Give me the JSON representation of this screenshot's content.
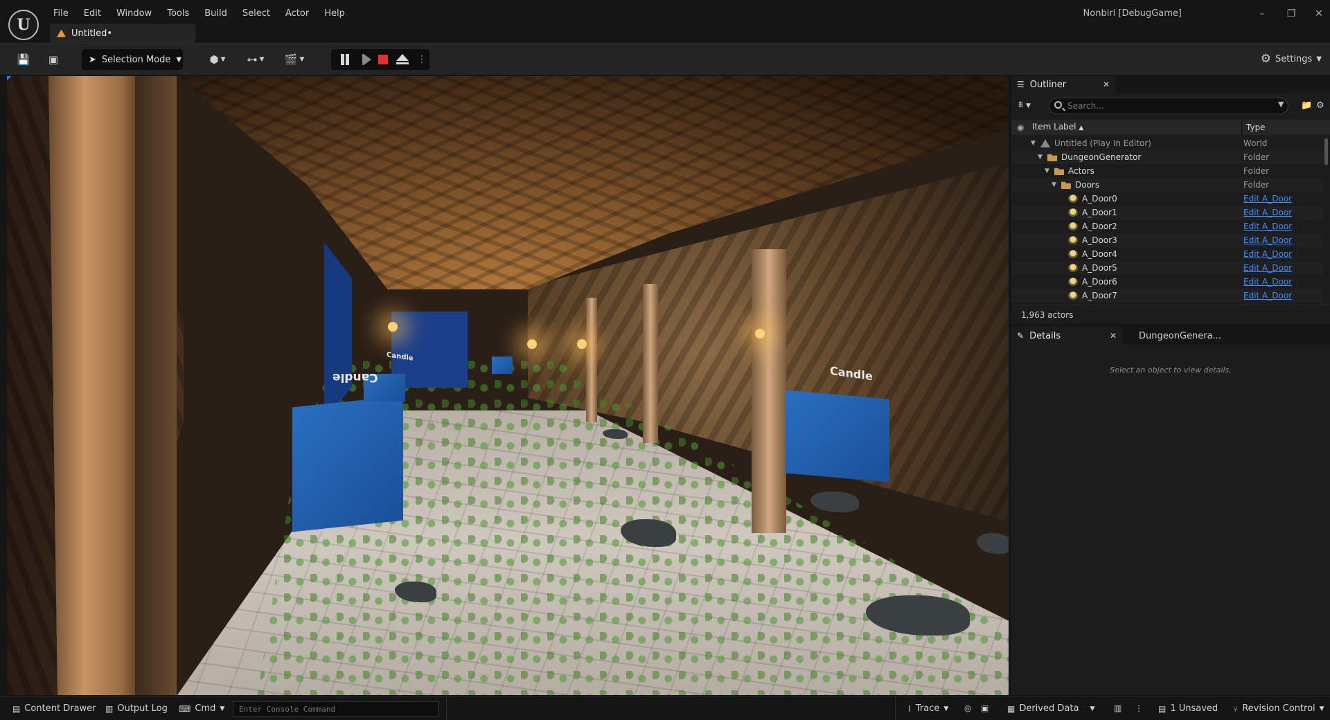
{
  "app": {
    "project_title": "Nonbiri [DebugGame]",
    "document_tab": "Untitled•"
  },
  "menu": [
    "File",
    "Edit",
    "Window",
    "Tools",
    "Build",
    "Select",
    "Actor",
    "Help"
  ],
  "toolbar": {
    "selection_mode": "Selection Mode",
    "settings": "Settings"
  },
  "viewport": {
    "labels": [
      "Candle",
      "Candle",
      "Candle"
    ]
  },
  "outliner": {
    "tab": "Outliner",
    "search_placeholder": "Search...",
    "col_label": "Item Label",
    "col_type": "Type",
    "rows": [
      {
        "label": "Untitled (Play In Editor)",
        "type": "World",
        "icon": "world-icon",
        "depth": 0,
        "expanded": true,
        "link": false
      },
      {
        "label": "DungeonGenerator",
        "type": "Folder",
        "icon": "folder-icon",
        "depth": 1,
        "expanded": true,
        "link": false
      },
      {
        "label": "Actors",
        "type": "Folder",
        "icon": "folder-icon",
        "depth": 2,
        "expanded": true,
        "link": false
      },
      {
        "label": "Doors",
        "type": "Folder",
        "icon": "folder-icon",
        "depth": 3,
        "expanded": true,
        "link": false
      },
      {
        "label": "A_Door0",
        "type": "Edit A_Door",
        "icon": "actor-icon",
        "depth": 4,
        "expanded": false,
        "link": true
      },
      {
        "label": "A_Door1",
        "type": "Edit A_Door",
        "icon": "actor-icon",
        "depth": 4,
        "expanded": false,
        "link": true
      },
      {
        "label": "A_Door2",
        "type": "Edit A_Door",
        "icon": "actor-icon",
        "depth": 4,
        "expanded": false,
        "link": true
      },
      {
        "label": "A_Door3",
        "type": "Edit A_Door",
        "icon": "actor-icon",
        "depth": 4,
        "expanded": false,
        "link": true
      },
      {
        "label": "A_Door4",
        "type": "Edit A_Door",
        "icon": "actor-icon",
        "depth": 4,
        "expanded": false,
        "link": true
      },
      {
        "label": "A_Door5",
        "type": "Edit A_Door",
        "icon": "actor-icon",
        "depth": 4,
        "expanded": false,
        "link": true
      },
      {
        "label": "A_Door6",
        "type": "Edit A_Door",
        "icon": "actor-icon",
        "depth": 4,
        "expanded": false,
        "link": true
      },
      {
        "label": "A_Door7",
        "type": "Edit A_Door",
        "icon": "actor-icon",
        "depth": 4,
        "expanded": false,
        "link": true
      }
    ],
    "actor_count": "1,963 actors"
  },
  "details": {
    "tab": "Details",
    "tab2": "DungeonGenera...",
    "empty_message": "Select an object to view details."
  },
  "statusbar": {
    "content_drawer": "Content Drawer",
    "output_log": "Output Log",
    "cmd": "Cmd",
    "console_placeholder": "Enter Console Command",
    "trace": "Trace",
    "derived_data": "Derived Data",
    "unsaved": "1 Unsaved",
    "revision_control": "Revision Control"
  },
  "colors": {
    "accent_blue": "#3d8eff",
    "stop_red": "#e0332c",
    "folder": "#c99752",
    "panel_bg": "#1c1c1c"
  }
}
